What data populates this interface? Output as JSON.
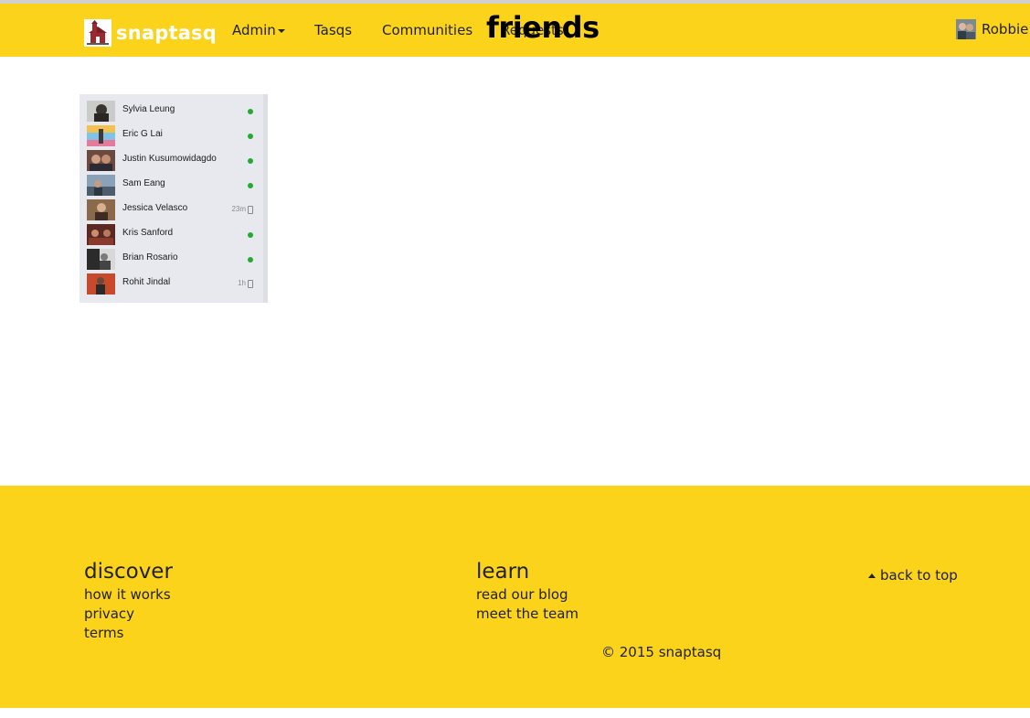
{
  "navbar": {
    "brand": "snaptasq",
    "menu": [
      "Admin",
      "Tasqs",
      "Communities"
    ],
    "obscured_item": "Requests",
    "page_title": "friends",
    "user_name": "Robbie"
  },
  "friends": [
    {
      "name": "Sylvia Leung",
      "status": "online"
    },
    {
      "name": "Eric G Lai",
      "status": "online"
    },
    {
      "name": "Justin Kusumowidagdo",
      "status": "online"
    },
    {
      "name": "Sam Eang",
      "status": "online"
    },
    {
      "name": "Jessica Velasco",
      "status": "mobile",
      "time": "23m"
    },
    {
      "name": "Kris Sanford",
      "status": "online"
    },
    {
      "name": "Brian Rosario",
      "status": "online"
    },
    {
      "name": "Rohit Jindal",
      "status": "mobile",
      "time": "1h"
    }
  ],
  "footer": {
    "discover": {
      "heading": "discover",
      "links": [
        "how it works",
        "privacy",
        "terms"
      ]
    },
    "learn": {
      "heading": "learn",
      "links": [
        "read our blog",
        "meet the team"
      ]
    },
    "back_to_top": "back to top",
    "copyright": "© 2015 snaptasq"
  },
  "colors": {
    "brand_yellow": "#fbd31a",
    "online_green": "#22aa33",
    "panel_bg": "#e8e9ee"
  }
}
